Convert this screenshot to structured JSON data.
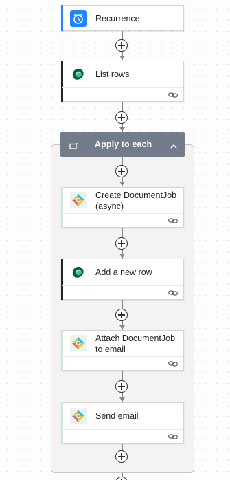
{
  "flow": {
    "steps": [
      {
        "title": "Recurrence",
        "icon": "clock-icon"
      },
      {
        "title": "List rows",
        "icon": "dataverse-icon"
      }
    ],
    "scope": {
      "title": "Apply to each",
      "icon": "loop-icon",
      "actions": [
        {
          "title": "Create DocumentJob\n(async)",
          "icon": "documentjob-icon"
        },
        {
          "title": "Add a new row",
          "icon": "dataverse-icon"
        },
        {
          "title": "Attach DocumentJob\nto email",
          "icon": "documentjob-icon"
        },
        {
          "title": "Send email",
          "icon": "documentjob-icon"
        }
      ]
    }
  },
  "colors": {
    "recurrence_accent": "#1f85ff",
    "dataverse_accent": "#242424",
    "documentjob_accent": "#cde8e0",
    "scope_header": "#727c8a"
  }
}
